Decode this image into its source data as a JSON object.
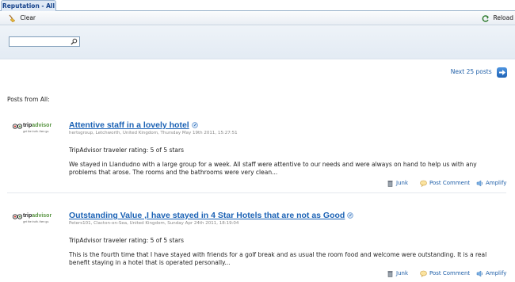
{
  "tab": {
    "label": "Reputation - All"
  },
  "toolbar": {
    "clear_label": "Clear",
    "reload_label": "Reload"
  },
  "search": {
    "value": "",
    "placeholder": ""
  },
  "pager": {
    "next_label": "Next 25 posts"
  },
  "section": {
    "label": "Posts from All:"
  },
  "logo": {
    "word_main": "trip",
    "word_accent": "advisor",
    "tagline": "get the truth. then go."
  },
  "posts": [
    {
      "title": "Attentive staff in a lovely hotel",
      "meta": "hertsgroup, Letchworth, United Kingdom, Thursday May 19th 2011, 15:27:51",
      "rating": "TripAdvisor traveler rating: 5 of 5 stars",
      "body": "We stayed in Llandudno with a large group for a week. All staff were attentive to our needs and were always on hand to help us with any problems that arose. The rooms and the bathrooms were very clean..."
    },
    {
      "title": "Outstanding Value ,I have stayed in 4 Star Hotels that are not as Good",
      "meta": "Peters101, Clacton-on-Sea, United Kingdom, Sunday Apr 24th 2011, 18:19:04",
      "rating": "TripAdvisor traveler rating: 5 of 5 stars",
      "body": "This is the fourth time that I have stayed with friends for a golf break and as usual the room food and welcome were outstanding. It is a real benefit staying in a hotel that is operated personally..."
    }
  ],
  "actions": {
    "junk": "Junk",
    "comment": "Post Comment",
    "amplify": "Amplify"
  },
  "colors": {
    "link": "#1b62b5",
    "tab_bg": "#dfe9f5",
    "band_bg": "#e3ebf4"
  }
}
